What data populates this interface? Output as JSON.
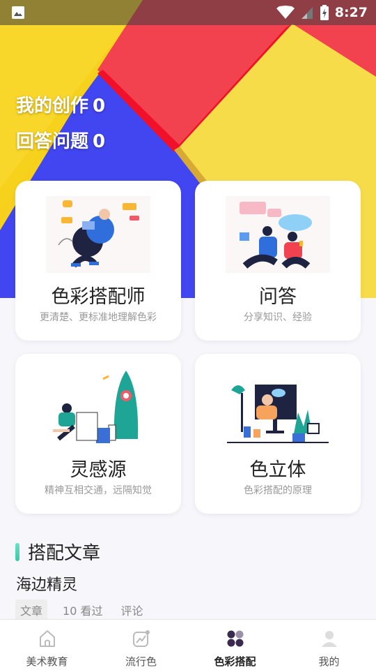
{
  "status_bar": {
    "time": "8:27"
  },
  "profile_stats": {
    "creations_label": "我的创作",
    "creations_count": "0",
    "answers_label": "回答问题",
    "answers_count": "0"
  },
  "cards": [
    {
      "title": "色彩搭配师",
      "subtitle": "更清楚、更标准地理解色彩"
    },
    {
      "title": "问答",
      "subtitle": "分享知识、经验"
    },
    {
      "title": "灵感源",
      "subtitle": "精神互相交通，远隔知觉"
    },
    {
      "title": "色立体",
      "subtitle": "色彩搭配的原理"
    }
  ],
  "section": {
    "title": "搭配文章"
  },
  "article": {
    "title": "海边精灵",
    "tag": "文章",
    "views": "10 看过",
    "comment": "评论"
  },
  "tabs": [
    {
      "label": "美术教育",
      "icon": "home-icon"
    },
    {
      "label": "流行色",
      "icon": "trend-chart-icon"
    },
    {
      "label": "色彩搭配",
      "icon": "color-dots-icon",
      "active": true
    },
    {
      "label": "我的",
      "icon": "profile-icon"
    }
  ],
  "colors": {
    "hero_yellow": "#f7d21c",
    "hero_red": "#f2424f",
    "hero_blue": "#4146f0",
    "accent_teal": "#3cc8a6"
  }
}
